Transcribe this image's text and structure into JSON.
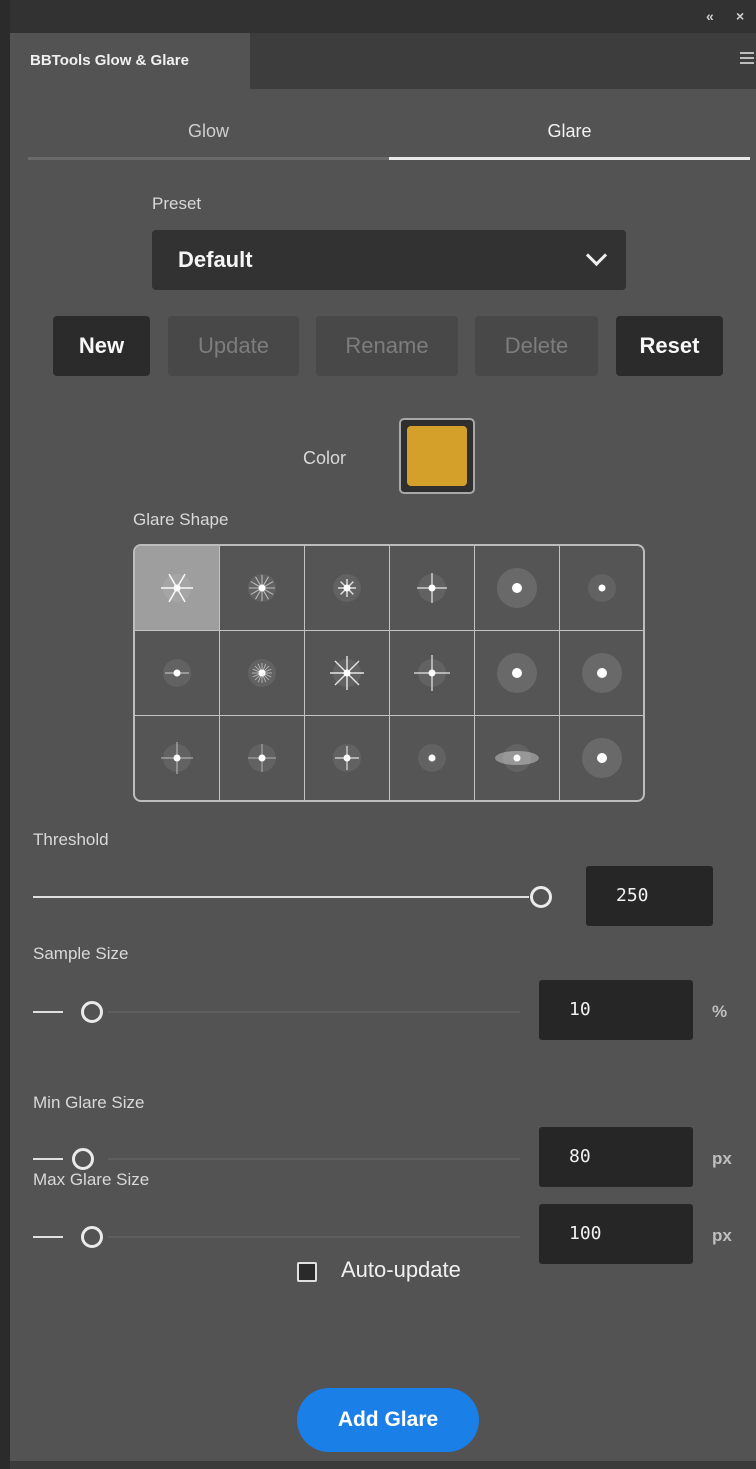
{
  "window": {
    "collapse_icon": "«",
    "close_icon": "×",
    "panel_title": "BBTools Glow & Glare",
    "menu_icon": "hamburger-menu-icon"
  },
  "tabs": [
    {
      "label": "Glow",
      "selected": false
    },
    {
      "label": "Glare",
      "selected": true
    }
  ],
  "preset": {
    "label": "Preset",
    "selected": "Default"
  },
  "preset_buttons": [
    {
      "label": "New",
      "enabled": true
    },
    {
      "label": "Update",
      "enabled": false
    },
    {
      "label": "Rename",
      "enabled": false
    },
    {
      "label": "Delete",
      "enabled": false
    },
    {
      "label": "Reset",
      "enabled": true
    }
  ],
  "color": {
    "label": "Color",
    "value": "#d4a02a"
  },
  "glare_shape": {
    "label": "Glare Shape",
    "selected_index": 0,
    "rows": 3,
    "cols": 6
  },
  "threshold": {
    "label": "Threshold",
    "value": "250",
    "level": 1.0
  },
  "sample_size": {
    "label": "Sample Size",
    "value": "10",
    "unit": "%",
    "level": 0.0
  },
  "min_glare_size": {
    "label": "Min Glare Size",
    "value": "80",
    "unit": "px",
    "level": 0.0
  },
  "max_glare_size": {
    "label": "Max Glare Size",
    "value": "100",
    "unit": "px",
    "level": 0.0
  },
  "auto_update": {
    "label": "Auto-update",
    "checked": false
  },
  "add_button": {
    "label": "Add Glare"
  },
  "colors": {
    "accent": "#1b7fe8",
    "panel_bg": "#535353",
    "field_bg": "#262626"
  }
}
